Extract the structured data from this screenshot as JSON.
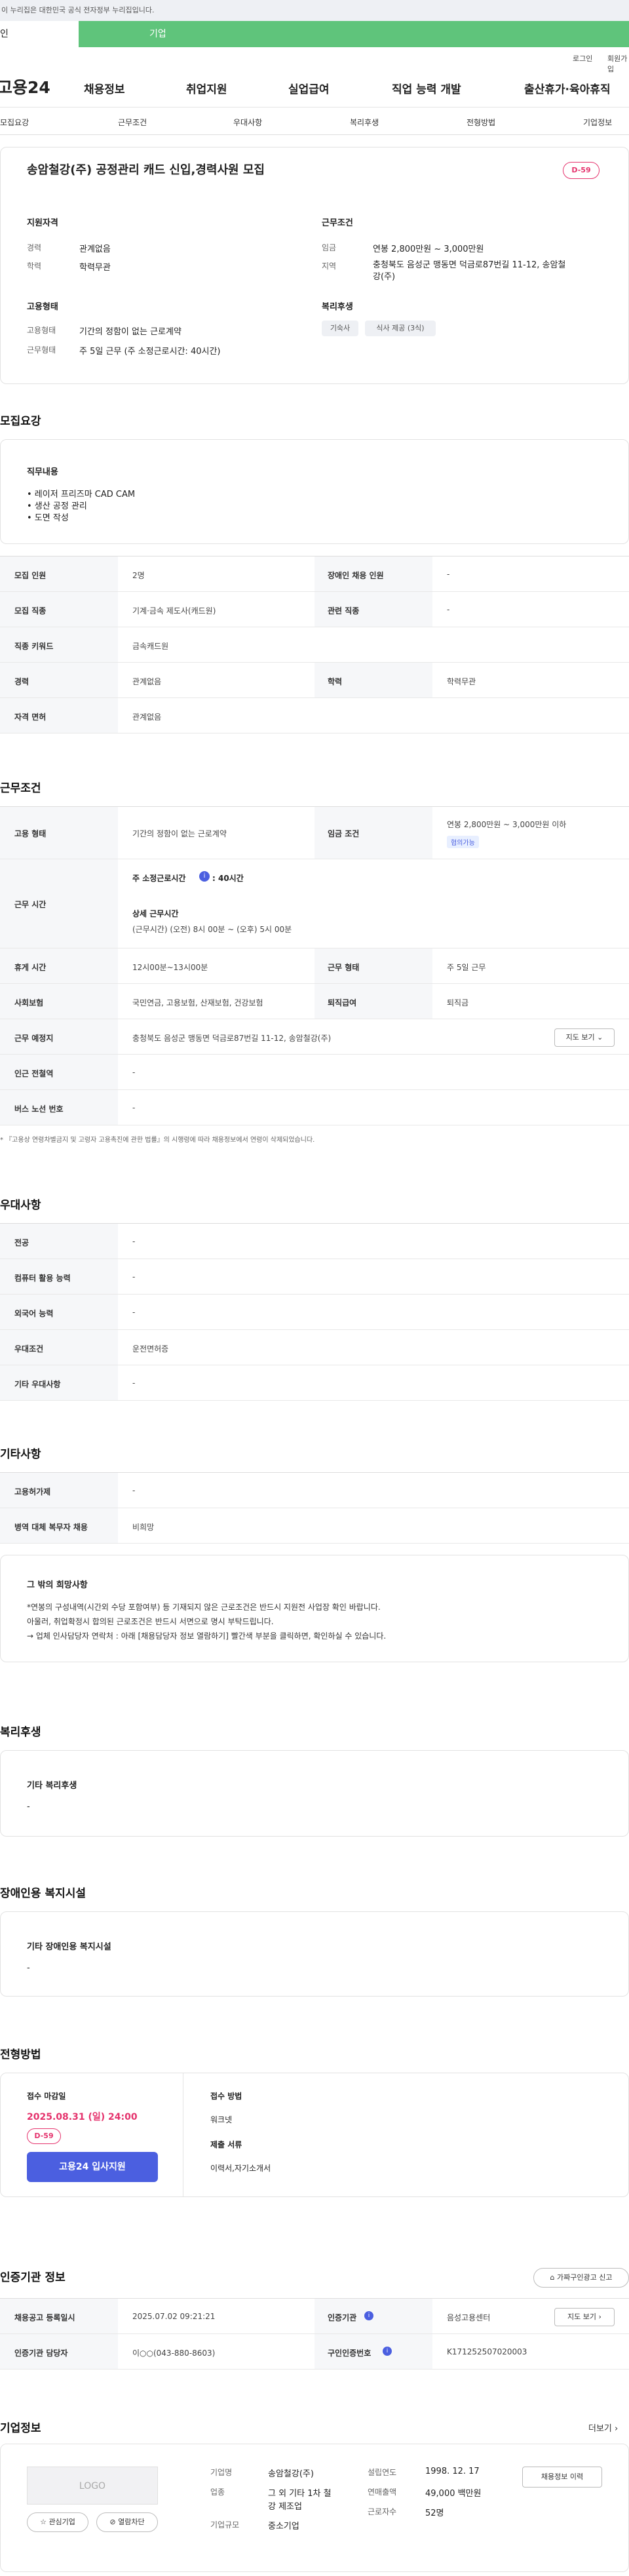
{
  "gov_notice": "이 누리집은 대한민국 공식 전자정부 누리집입니다.",
  "top_tabs": {
    "personal": "인",
    "company": "기업"
  },
  "util": {
    "login": "로그인",
    "signup": "회원가입"
  },
  "gnb": {
    "logo": "고용24",
    "menus": [
      "채용정보",
      "취업지원",
      "실업급여",
      "직업 능력 개발",
      "출산휴가·육아휴직"
    ]
  },
  "subnav": [
    "모집요강",
    "근무조건",
    "우대사항",
    "복리후생",
    "전형방법",
    "기업정보"
  ],
  "header": {
    "title": "송암철강(주) 공정관리 캐드 신입,경력사원 모집",
    "dday": "D-59",
    "qual_title": "지원자격",
    "career_label": "경력",
    "career_value": "관계없음",
    "edu_label": "학력",
    "edu_value": "학력무관",
    "cond_title": "근무조건",
    "wage_label": "임금",
    "wage_value": "연봉 2,800만원 ~ 3,000만원",
    "region_label": "지역",
    "region_value_1": "충청북도 음성군 맹동면 덕금로87번길 11-12, 송암철",
    "region_value_2": "강(주)",
    "emp_title": "고용형태",
    "emptype_label": "고용형태",
    "emptype_value": "기간의 정함이 없는 근로계약",
    "worktype_label": "근무형태",
    "worktype_value": "주 5일 근무 (주 소정근로시간: 40시간)",
    "welfare_title": "복리후생",
    "welfare_chips": [
      "기숙사",
      "식사 제공 (3식)"
    ]
  },
  "recruit": {
    "section_title": "모집요강",
    "duty_title": "직무내용",
    "duties": [
      "• 레이저 프리즈마 CAD CAM",
      "• 생산 공정 관리",
      "• 도면 작성"
    ],
    "table": [
      {
        "h1": "모집 인원",
        "v1": "2명",
        "h2": "장애인 채용 인원",
        "v2": "-"
      },
      {
        "h1": "모집 직종",
        "v1": "기계·금속 제도사(캐드원)",
        "h2": "관련 직종",
        "v2": "-"
      },
      {
        "h1": "직종 키워드",
        "v1": "금속캐드원",
        "h2": "",
        "v2": ""
      },
      {
        "h1": "경력",
        "v1": "관계없음",
        "h2": "학력",
        "v2": "학력무관"
      },
      {
        "h1": "자격 면허",
        "v1": "관계없음",
        "h2": "",
        "v2": ""
      }
    ]
  },
  "work": {
    "section_title": "근무조건",
    "emptype_h": "고용 형태",
    "emptype_v": "기간의 정함이 없는 근로계약",
    "wage_h": "임금 조건",
    "wage_v": "연봉 2,800만원 ~ 3,000만원 이하",
    "wage_badge": "협의가능",
    "hours_h": "근무 시간",
    "hours_line1": "주 소정근로시간",
    "hours_line1b": ": 40시간",
    "hours_detail_title": "상세 근무시간",
    "hours_detail": "(근무시간) (오전) 8시 00분 ~ (오후) 5시 00분",
    "break_h": "휴게 시간",
    "break_v": "12시00분~13시00분",
    "worktype_h": "근무 형태",
    "worktype_v": "주 5일 근무",
    "insurance_h": "사회보험",
    "insurance_v": "국민연금, 고용보험, 산재보험, 건강보험",
    "severance_h": "퇴직급여",
    "severance_v": "퇴직금",
    "place_h": "근무 예정지",
    "place_v": "충청북도 음성군 맹동면 덕금로87번길 11-12, 송암철강(주)",
    "map_btn": "지도 보기",
    "station_h": "인근 전철역",
    "station_v": "-",
    "bus_h": "버스 노선 번호",
    "bus_v": "-",
    "note": "* 『고용상 연령차별금지 및 고령자 고용촉진에 관한 법률』의 시행령에 따라 채용정보에서 연령이 삭제되었습니다."
  },
  "pref": {
    "section_title": "우대사항",
    "rows": [
      {
        "h": "전공",
        "v": "-"
      },
      {
        "h": "컴퓨터 활용 능력",
        "v": "-"
      },
      {
        "h": "외국어 능력",
        "v": "-"
      },
      {
        "h": "우대조건",
        "v": "운전면허증"
      },
      {
        "h": "기타 우대사항",
        "v": "-"
      }
    ]
  },
  "etc": {
    "section_title": "기타사항",
    "rows": [
      {
        "h": "고용허가제",
        "v": "-"
      },
      {
        "h": "병역 대체 복무자 채용",
        "v": "비희망"
      }
    ],
    "box_title": "그 밖의 희망사항",
    "box_lines": [
      "*연봉의 구성내역(시간외 수당 포함여부) 등 기재되지 않은 근로조건은 반드시 지원전 사업장 확인 바랍니다.",
      "아울러, 취업확정시 합의된 근로조건은 반드시 서면으로 명시 부탁드립니다.",
      "→ 업체 인사담당자 연락처 : 아래 [채용담당자 정보 열람하기] 빨간색 부분을 클릭하면, 확인하실 수 있습니다."
    ]
  },
  "welfare": {
    "section_title": "복리후생",
    "box_title": "기타 복리후생",
    "box_value": "-"
  },
  "disabled": {
    "section_title": "장애인용 복지시설",
    "box_title": "기타 장애인용 복지시설",
    "box_value": "-"
  },
  "process": {
    "section_title": "전형방법",
    "deadline_title": "접수 마감일",
    "deadline": "2025.08.31 (일) 24:00",
    "dday": "D-59",
    "apply_btn": "고용24 입사지원",
    "method_title": "접수 방법",
    "method_value": "워크넷",
    "docs_title": "제출 서류",
    "docs_value": "이력서,자기소개서"
  },
  "cert": {
    "section_title": "인증기관 정보",
    "report_btn": "가짜구인광고 신고",
    "r1h1": "채용공고 등록일시",
    "r1v1": "2025.07.02 09:21:21",
    "r1h2": "인증기관",
    "r1v2": "음성고용센터",
    "map_btn": "지도 보기",
    "r2h1": "인증기관 담당자",
    "r2v1": "이○○(043-880-8603)",
    "r2h2": "구인인증번호",
    "r2v2": "K171252507020003"
  },
  "company": {
    "section_title": "기업정보",
    "more": "더보기",
    "logo_text": "LOGO",
    "interest_btn": "관심기업",
    "block_btn": "열람차단",
    "name_l": "기업명",
    "name_v": "송암철강(주)",
    "industry_l": "업종",
    "industry_v1": "그 외 기타 1차 철",
    "industry_v2": "강 제조업",
    "size_l": "기업규모",
    "size_v": "중소기업",
    "founded_l": "설립연도",
    "founded_v": "1998. 12. 17",
    "sales_l": "연매출액",
    "sales_v": "49,000 백만원",
    "staff_l": "근로자수",
    "staff_v": "52명",
    "jobs_btn": "채용정보 이력"
  },
  "colors": {
    "accent": "#4b5fe0",
    "dday": "#e5336d",
    "green": "#5fc47b"
  }
}
